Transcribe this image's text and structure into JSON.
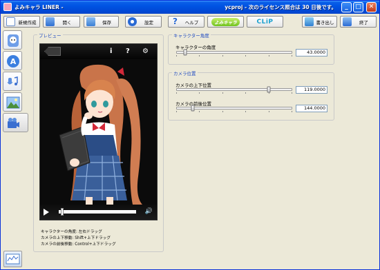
{
  "window": {
    "title": "よみキャラ LINER -",
    "status": "ycproj - 次のライセンス照合は 30 日後です。",
    "min": "_",
    "max": "□",
    "close": "✕"
  },
  "toolbar": {
    "new_label": "新規作成",
    "open_label": "開く",
    "save_label": "保存",
    "settings_label": "設定",
    "help_label": "ヘルプ",
    "link1_label": "よみキャラ",
    "link2_label": "CLiP",
    "export_label": "書き出し",
    "exit_label": "終了"
  },
  "preview": {
    "legend": "プレビュー",
    "info_icon": "i",
    "help_icon": "?",
    "settings_icon": "⚙",
    "volume_icon": "🔊",
    "help_lines": [
      "キャラクターの角度: 左右ドラッグ",
      "カメラの上下移動: Shift+上下ドラッグ",
      "カメラの前後移動: Control+上下ドラッグ"
    ],
    "progress": 0.03
  },
  "character_angle": {
    "legend": "キャラクター角度",
    "label": "キャラクターの角度",
    "value": "43.0000",
    "position": 0.08
  },
  "camera": {
    "legend": "カメラ位置",
    "vertical_label": "カメラの上下位置",
    "vertical_value": "119.0000",
    "vertical_position": 0.8,
    "depth_label": "カメラの前後位置",
    "depth_value": "144.0000",
    "depth_position": 0.14
  },
  "colors": {
    "titlebar": "#0054e3",
    "accent": "#1f4ac0",
    "hair": "#c9744a",
    "uniform": "#2b4d86",
    "ribbon": "#d3293a"
  }
}
